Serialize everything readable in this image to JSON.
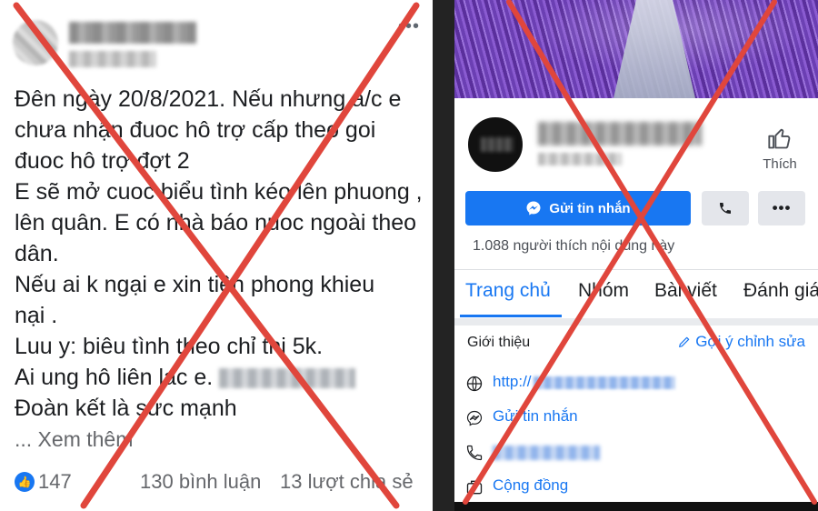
{
  "left_post": {
    "more_label": "•••",
    "lines": [
      "Đên ngày 20/8/2021. Nếu nhưng a/c e",
      "chưa nhận đuoc hô trợ cấp theo goi",
      "đuoc hô trợ đợt 2",
      "E sẽ mở cuoc biểu tình kéo lên phuong ,",
      "lên quân. E có nhà báo nuoc ngoài theo",
      "dân.",
      " Nếu ai k ngại e xin tiên phong khieu",
      "nại .",
      "Luu y:  biêu tình theo chỉ thị 5k.",
      "Ai ung hô liên lac e.",
      "Đoàn kết là sưc  mạnh"
    ],
    "see_more": "... Xem thêm",
    "reactions_count": "147",
    "comments": "130 bình luận",
    "shares": "13 lượt chia sẻ",
    "icons": {
      "like": "like-icon",
      "menu": "more-options-icon"
    }
  },
  "right_page": {
    "like_label": "Thích",
    "message_button": "Gửi tin nhắn",
    "likes_text": "1.088 người thích nội dung này",
    "tabs": [
      "Trang chủ",
      "Nhóm",
      "Bài viết",
      "Đánh giá"
    ],
    "active_tab": "Trang chủ",
    "intro_title": "Giới thiệu",
    "edit_link": "Gợi ý chỉnh sửa",
    "info": {
      "website_prefix": "http://",
      "send_message": "Gửi tin nhắn",
      "category": "Cộng đồng"
    },
    "icons": {
      "thumb": "thumbs-up-icon",
      "messenger": "messenger-icon",
      "phone": "phone-icon",
      "more": "more-icon",
      "pencil": "pencil-icon",
      "globe": "globe-icon",
      "community": "community-icon"
    }
  },
  "colors": {
    "facebook_blue": "#1877f2",
    "cross_red": "#e0463c",
    "text_dark": "#1c1e21",
    "text_gray": "#65676b",
    "lavender": "#7d4fc4"
  }
}
